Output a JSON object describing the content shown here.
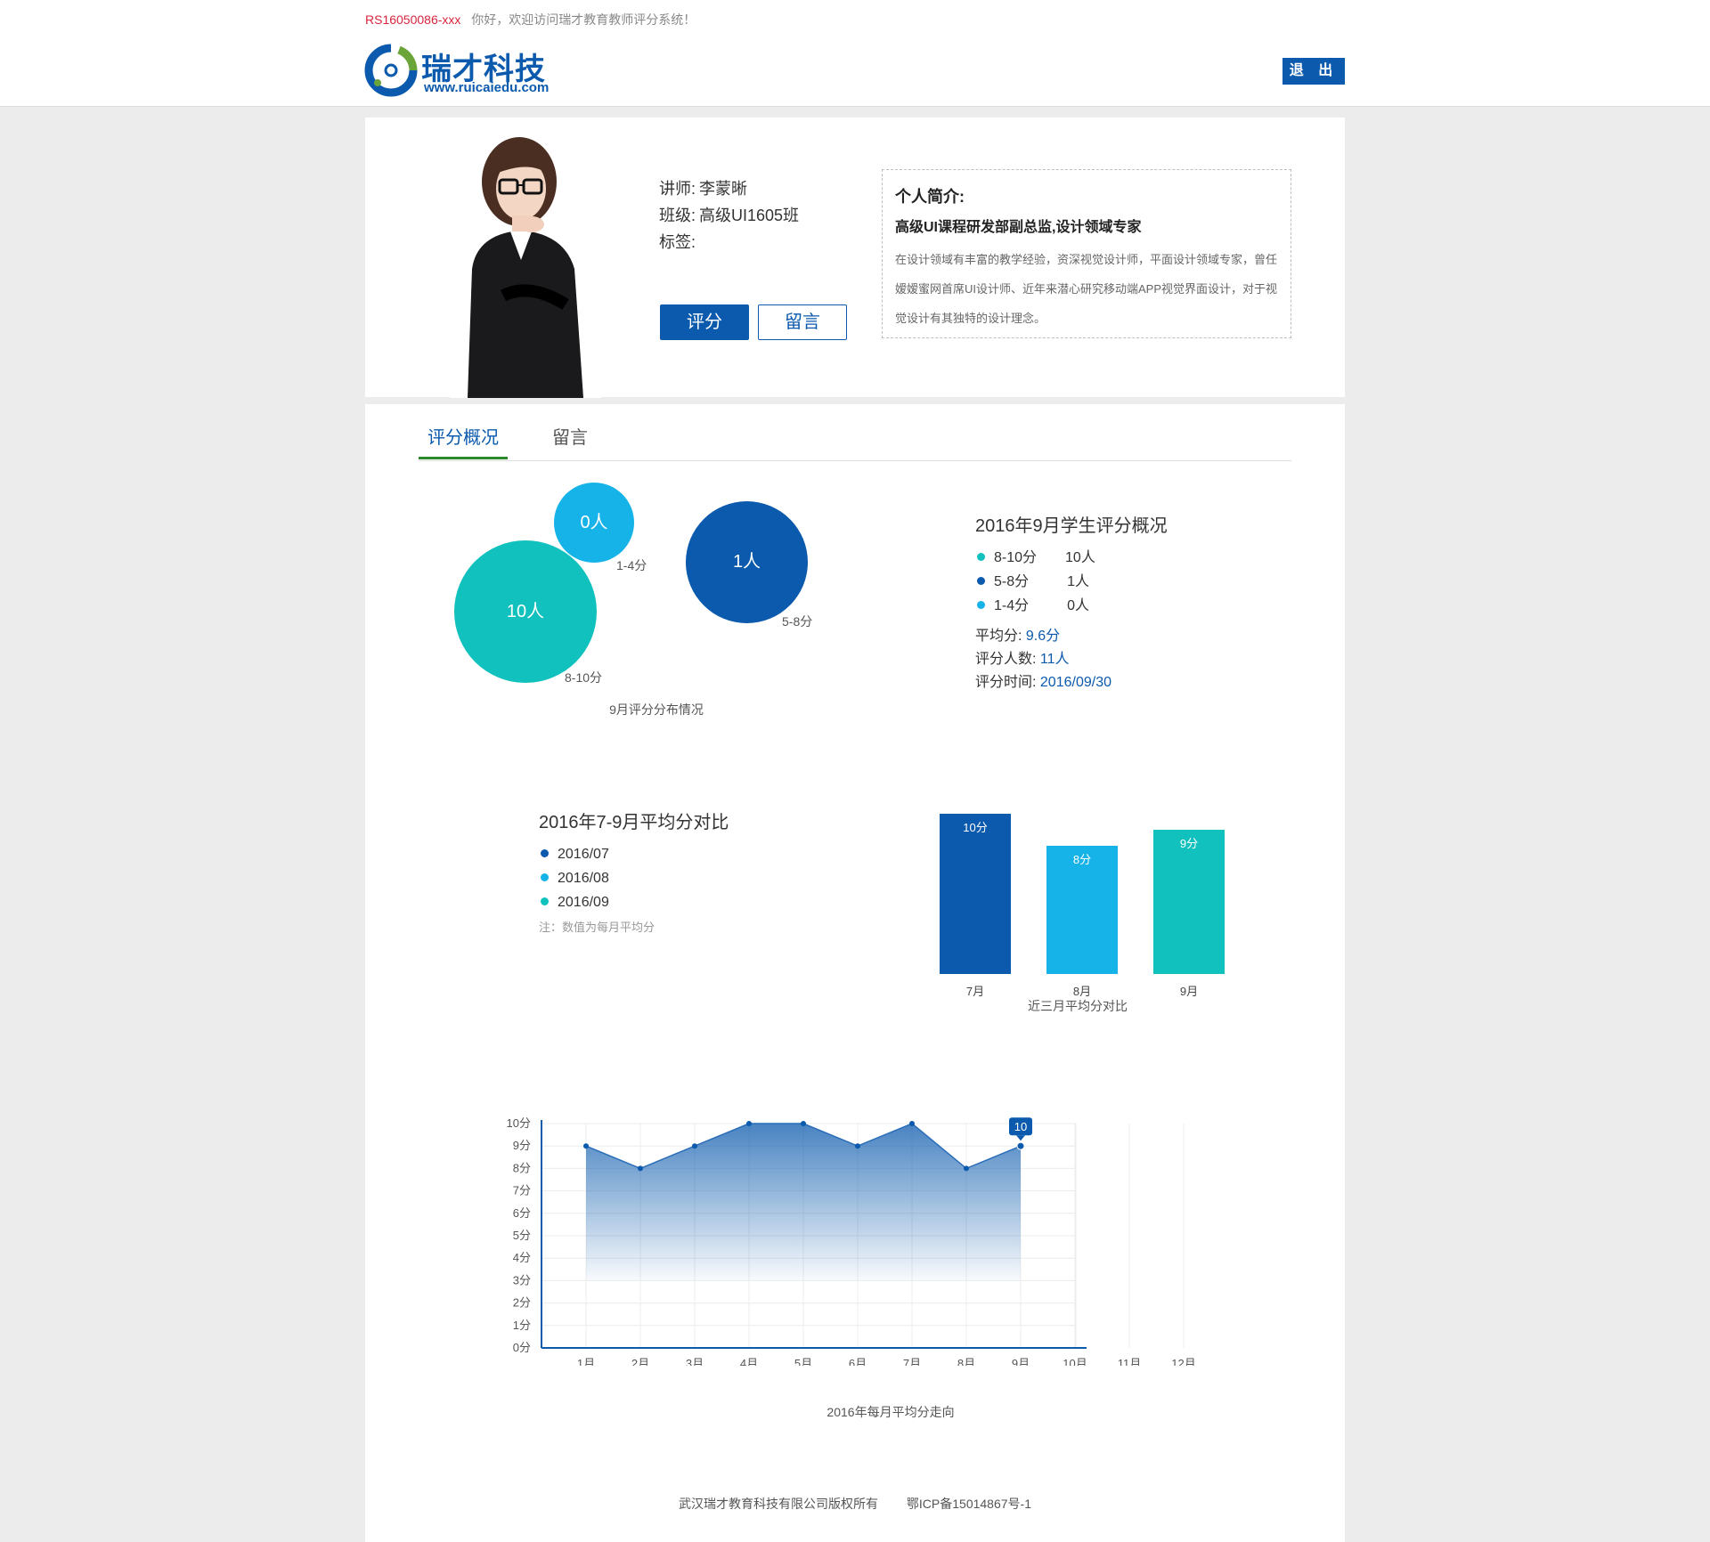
{
  "header": {
    "user_id": "RS16050086-xxx",
    "welcome": "你好，欢迎访问瑞才教育教师评分系统！",
    "logo_text": "瑞才科技",
    "logo_url": "www.ruicaiedu.com",
    "logout_label": "退 出"
  },
  "teacher": {
    "lecturer_label": "讲师:",
    "lecturer_name": "李蒙晰",
    "class_label": "班级:",
    "class_name": "高级UI1605班",
    "tag_label": "标签:",
    "rate_button": "评分",
    "message_button": "留言"
  },
  "intro": {
    "title": "个人简介:",
    "subtitle": "高级UI课程研发部副总监,设计领域专家",
    "body": "在设计领域有丰富的教学经验，资深视觉设计师，平面设计领域专家，曾任嫒嫒蜜网首席UI设计师、近年来潜心研究移动端APP视觉界面设计，对于视觉设计有其独特的设计理念。"
  },
  "tabs": [
    {
      "label": "评分概况",
      "active": true
    },
    {
      "label": "留言",
      "active": false
    }
  ],
  "colors": {
    "brand": "#0b5aad",
    "teal": "#11c1be",
    "sky": "#16b3e8",
    "navy": "#0b5aad"
  },
  "september": {
    "title": "2016年9月学生评分概况",
    "caption": "9月评分分布情况",
    "ranges": [
      {
        "range": "8-10分",
        "count": "10人",
        "bubble": "10人",
        "color": "#11c1be"
      },
      {
        "range": "5-8分",
        "count": "1人",
        "bubble": "1人",
        "color": "#0b5aad"
      },
      {
        "range": "1-4分",
        "count": "0人",
        "bubble": "0人",
        "color": "#16b3e8"
      }
    ],
    "avg_label": "平均分:",
    "avg_value": "9.6分",
    "raters_label": "评分人数:",
    "raters_value": "11人",
    "time_label": "评分时间:",
    "time_value": "2016/09/30"
  },
  "comparison": {
    "title": "2016年7-9月平均分对比",
    "legend": [
      "2016/07",
      "2016/08",
      "2016/09"
    ],
    "note": "注：数值为每月平均分",
    "caption": "近三月平均分对比"
  },
  "trend": {
    "caption": "2016年每月平均分走向"
  },
  "chart_data": [
    {
      "type": "bar",
      "title": "近三月平均分对比",
      "categories": [
        "7月",
        "8月",
        "9月"
      ],
      "values": [
        10,
        8,
        9
      ],
      "value_labels": [
        "10分",
        "8分",
        "9分"
      ],
      "colors": [
        "#0b5aad",
        "#16b3e8",
        "#11c1be"
      ],
      "ylim": [
        0,
        10
      ]
    },
    {
      "type": "area",
      "title": "2016年每月平均分走向",
      "categories": [
        "1月",
        "2月",
        "3月",
        "4月",
        "5月",
        "6月",
        "7月",
        "8月",
        "9月",
        "10月",
        "11月",
        "12月"
      ],
      "values": [
        9,
        8,
        9,
        10,
        10,
        9,
        10,
        8,
        9
      ],
      "ylim": [
        0,
        10
      ],
      "yticks": [
        "0分",
        "1分",
        "2分",
        "3分",
        "4分",
        "5分",
        "6分",
        "7分",
        "8分",
        "9分",
        "10分"
      ],
      "highlight_label": "10",
      "grid": true
    }
  ],
  "footer": {
    "company": "武汉瑞才教育科技有限公司版权所有",
    "icp": "鄂ICP备15014867号-1"
  }
}
